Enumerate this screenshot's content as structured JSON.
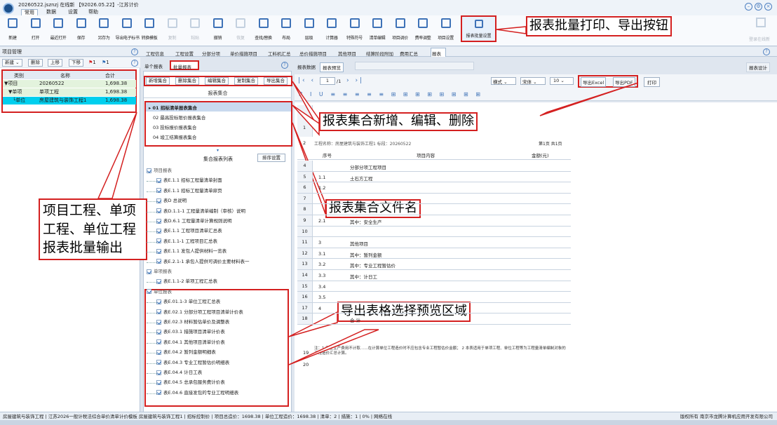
{
  "titlebar": {
    "title": "20260522.jsznzj 在线新 【92026.05.22】-江苏计价",
    "menu": [
      "常用",
      "数据",
      "设置",
      "帮助"
    ]
  },
  "toolbar": {
    "buttons": [
      {
        "label": "新建",
        "dim": false
      },
      {
        "label": "打开",
        "dim": false
      },
      {
        "label": "最近打开",
        "dim": false
      },
      {
        "label": "保存",
        "dim": false
      },
      {
        "label": "另存为",
        "dim": false
      },
      {
        "label": "导出电子标书",
        "dim": false
      },
      {
        "label": "转换模板",
        "dim": false
      },
      {
        "label": "复制",
        "dim": true
      },
      {
        "label": "粘贴",
        "dim": true
      },
      {
        "label": "撤销",
        "dim": false
      },
      {
        "label": "恢复",
        "dim": true
      },
      {
        "label": "查找/替换",
        "dim": false
      },
      {
        "label": "布局",
        "dim": false
      },
      {
        "label": "层级",
        "dim": false
      },
      {
        "label": "计算器",
        "dim": false
      },
      {
        "label": "特殊符号",
        "dim": false
      },
      {
        "label": "清单编辑",
        "dim": false
      },
      {
        "label": "项目调价",
        "dim": false
      },
      {
        "label": "费率调整",
        "dim": false
      },
      {
        "label": "项目设置",
        "dim": false
      }
    ],
    "highlight": "报表批量设置",
    "right": "登录在线新"
  },
  "callouts": {
    "c1": "报表批量打印、导出按钮",
    "c2": "报表集合新增、编辑、删除",
    "c3": "报表集合文件名",
    "c4": "项目工程、单项工程、单位工程报表批量输出",
    "c5": "导出表格选择预览区域"
  },
  "left": {
    "header": "项目管理",
    "tools": [
      "新建",
      "删除",
      "上移",
      "下移"
    ],
    "flags": "1",
    "flags2": "1",
    "cols": [
      "类别",
      "名称",
      "合计"
    ],
    "rows": [
      {
        "type": "▼项目",
        "name": "20260522",
        "total": "1,698.38"
      },
      {
        "type": "▼单项",
        "name": "单项工程",
        "total": "1,698.38"
      },
      {
        "type": "└单位",
        "name": "房屋建筑与装饰工程1",
        "total": "1,698.38"
      }
    ]
  },
  "tabs": [
    "工程信息",
    "工程设置",
    "分部分项",
    "单价措施项目",
    "工料机汇总",
    "总价措施项目",
    "其他项目",
    "结算阶段附加",
    "费用汇总",
    "报表"
  ],
  "subtabs": [
    "单个报表",
    "批量报表"
  ],
  "settools": [
    "新增集合",
    "删除集合",
    "编辑集合",
    "复制集合",
    "导出集合"
  ],
  "settitle": "报表集合",
  "sets": [
    "▸ 01 招标清单报表集合",
    "02 最高投标限价报表集合",
    "03 投标报价报表集合",
    "04 竣工结算报表集合"
  ],
  "listtitle": "集合报表列表",
  "sortbtn": "排序设置",
  "list": [
    {
      "t": "项目报表",
      "lvl": 0
    },
    {
      "t": "表E.1.1 招标工程量清单封面",
      "lvl": 1
    },
    {
      "t": "表E.1.1 招标工程量清单扉页",
      "lvl": 1
    },
    {
      "t": "表D 总说明",
      "lvl": 1
    },
    {
      "t": "表D.1.1-1 工程量清单编制（审核）说明",
      "lvl": 1
    },
    {
      "t": "表D.6.1 工程量清单计算规则说明",
      "lvl": 1
    },
    {
      "t": "表E.1.1 工程项目清单汇总表",
      "lvl": 1
    },
    {
      "t": "表E.1.1-1 工程项目汇总表",
      "lvl": 1
    },
    {
      "t": "表E.1.1 发包人提供材料一览表",
      "lvl": 1
    },
    {
      "t": "表E.2.1-1 承包人提供可调价主要材料表一",
      "lvl": 1
    },
    {
      "t": "单项报表",
      "lvl": 0
    },
    {
      "t": "表E.1.1-2 单项工程汇总表",
      "lvl": 1
    },
    {
      "t": "单位报表",
      "lvl": 0
    },
    {
      "t": "表E.01.1-3 单位工程汇总表",
      "lvl": 1
    },
    {
      "t": "表E.02.1 分部分项工程项目清单计价表",
      "lvl": 1
    },
    {
      "t": "表E.02.3 材料暂估单价及调整表",
      "lvl": 1
    },
    {
      "t": "表E.03.1 措施项目清单计价表",
      "lvl": 1
    },
    {
      "t": "表E.04.1 其他项目清单计价表",
      "lvl": 1
    },
    {
      "t": "表E.04.2 暂列金额明细表",
      "lvl": 1
    },
    {
      "t": "表E.04.3 专业工程暂估价明细表",
      "lvl": 1
    },
    {
      "t": "表E.04.4 计日工表",
      "lvl": 1
    },
    {
      "t": "表E.04.5 总承包服务费计价表",
      "lvl": 1
    },
    {
      "t": "表E.04.6 直接发包的专业工程明细表",
      "lvl": 1
    }
  ],
  "right": {
    "tabs": [
      "报表数据",
      "报表预览"
    ],
    "design": "报表设计",
    "page": "1",
    "pages": "/1",
    "format": "横式",
    "font": "宋体",
    "size": "10",
    "exportExcel": "导出Excel",
    "exportPdf": "导出PDF",
    "print": "打印",
    "projname": "工程名称：房屋建筑与装饰工程1  标段：20260522",
    "pageinfo": "第1页 共1页",
    "head": [
      "序号",
      "项目内容",
      "金额(元)"
    ],
    "rows": [
      {
        "n": "4",
        "a": "",
        "b": "分部分项工程项目"
      },
      {
        "n": "5",
        "a": "1.1",
        "b": "土石方工程"
      },
      {
        "n": "6",
        "a": "1.2",
        "b": ""
      },
      {
        "n": "7",
        "a": "",
        "b": ""
      },
      {
        "n": "8",
        "a": "",
        "b": ""
      },
      {
        "n": "9",
        "a": "2.1",
        "b": "其中：安全生产"
      },
      {
        "n": "10",
        "a": "",
        "b": ""
      },
      {
        "n": "11",
        "a": "3",
        "b": "其他项目"
      },
      {
        "n": "12",
        "a": "3.1",
        "b": "其中：暂列金额"
      },
      {
        "n": "13",
        "a": "3.2",
        "b": "其中：专业工程暂估价"
      },
      {
        "n": "14",
        "a": "3.3",
        "b": "其中：计日工"
      },
      {
        "n": "15",
        "a": "3.4",
        "b": ""
      },
      {
        "n": "16",
        "a": "3.5",
        "b": ""
      },
      {
        "n": "17",
        "a": "4",
        "b": ""
      },
      {
        "n": "18",
        "a": "",
        "b": "合 计"
      }
    ],
    "note": "注：1 安全生产费用不计取……在计算单位工程造价时不应包含专业工程暂估价金额；  2 本表适用于单项工程、单位工程等为工程量清单编制对象的工程造价汇总计算。"
  },
  "status": "房屋建筑与装饰工程 | 江苏2026一般计税法综合单价清单计价模板 房屋建筑与装饰工程1 | 招标控制价 | 项目总造价：1698.38 | 单位工程造价：1698.38 | 清单：2 | 措施：1 | 0% | 网络在线",
  "status_right": "版权所有 南京市龙腾计算机应用开发有限公司"
}
